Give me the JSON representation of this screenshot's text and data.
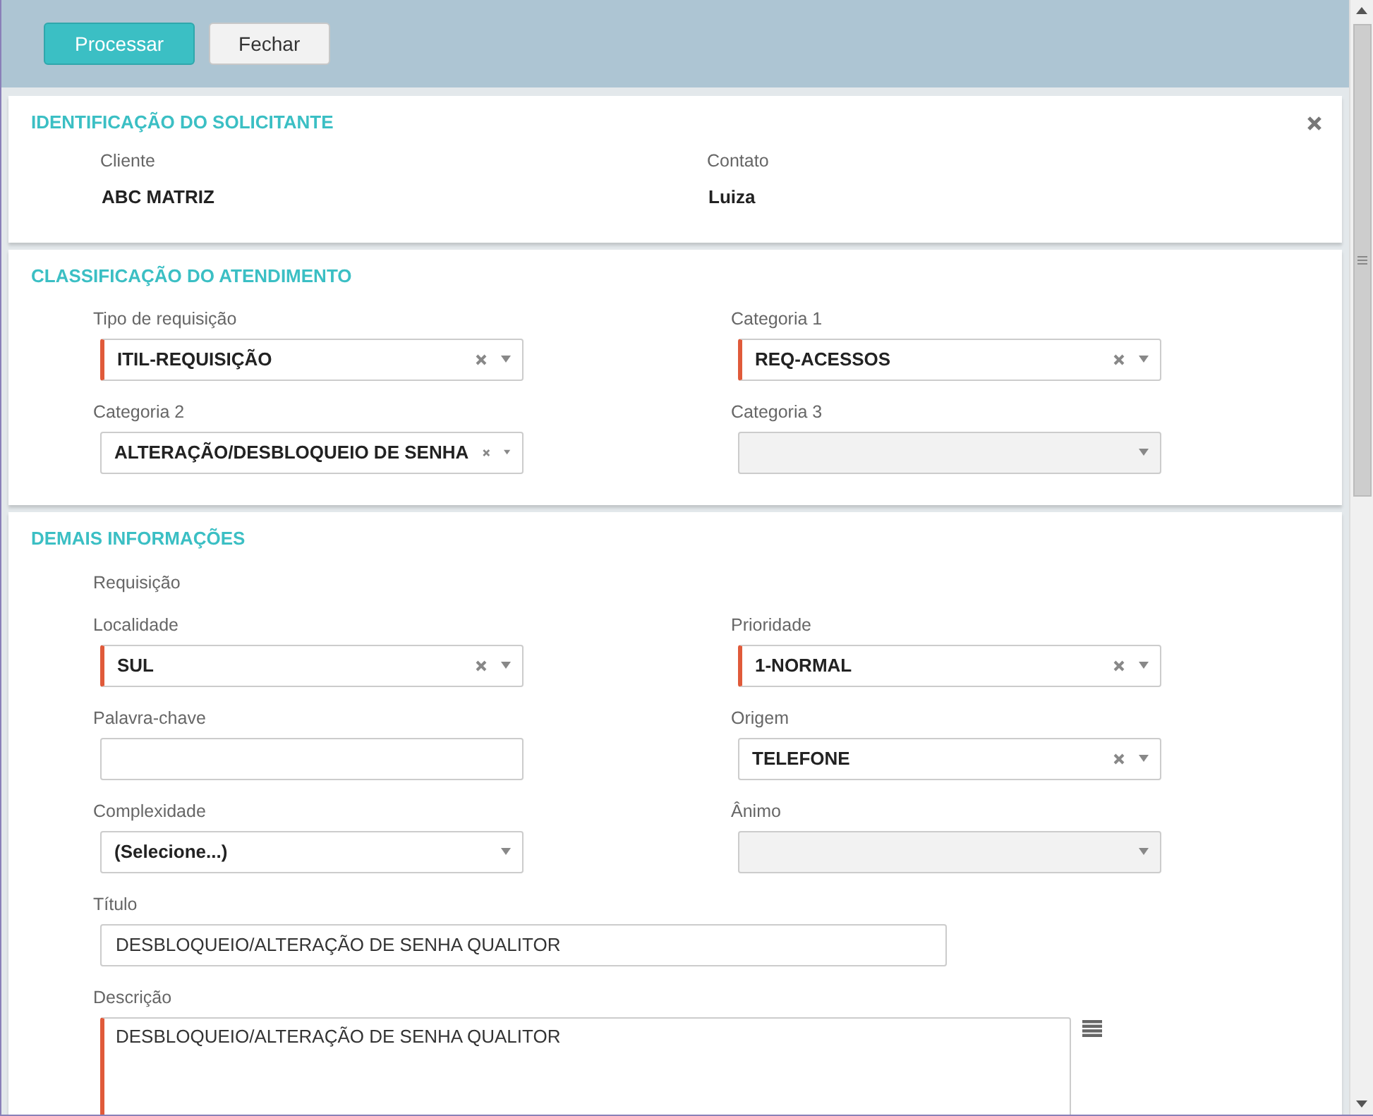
{
  "toolbar": {
    "buttons": [
      {
        "label": "Processar",
        "kind": "primary"
      },
      {
        "label": "Fechar",
        "kind": "default"
      }
    ]
  },
  "sections": [
    {
      "title": "IDENTIFICAÇÃO DO SOLICITANTE",
      "closable": true,
      "info": [
        {
          "label": "Cliente",
          "value": "ABC MATRIZ"
        },
        {
          "label": "Contato",
          "value": "Luiza"
        }
      ]
    },
    {
      "title": "CLASSIFICAÇÃO DO ATENDIMENTO",
      "closable": false,
      "fields": [
        {
          "label": "Tipo de requisição",
          "kind": "select",
          "value": "ITIL-REQUISIÇÃO",
          "required": true,
          "clearable": true,
          "disabled": false
        },
        {
          "label": "Categoria 1",
          "kind": "select",
          "value": "REQ-ACESSOS",
          "required": true,
          "clearable": true,
          "disabled": false
        },
        {
          "label": "Categoria 2",
          "kind": "select",
          "value": "ALTERAÇÃO/DESBLOQUEIO DE SENHA",
          "required": false,
          "clearable": true,
          "disabled": false
        },
        {
          "label": "Categoria 3",
          "kind": "select",
          "required": false,
          "clearable": false,
          "disabled": true
        }
      ]
    },
    {
      "title": "DEMAIS INFORMAÇÕES",
      "closable": false,
      "note": "Requisição",
      "fields": [
        {
          "label": "Localidade",
          "kind": "select",
          "value": "SUL",
          "required": true,
          "clearable": true,
          "disabled": false
        },
        {
          "label": "Prioridade",
          "kind": "select",
          "value": "1-NORMAL",
          "required": true,
          "clearable": true,
          "disabled": false
        },
        {
          "label": "Palavra-chave",
          "kind": "text",
          "required": false
        },
        {
          "label": "Origem",
          "kind": "select",
          "value": "TELEFONE",
          "required": false,
          "clearable": true,
          "disabled": false
        },
        {
          "label": "Complexidade",
          "kind": "select",
          "value": "(Selecione...)",
          "required": false,
          "clearable": false,
          "disabled": false
        },
        {
          "label": "Ânimo",
          "kind": "select",
          "required": false,
          "clearable": false,
          "disabled": true
        }
      ],
      "long_fields": [
        {
          "label": "Título",
          "kind": "text",
          "value": "DESBLOQUEIO/ALTERAÇÃO DE SENHA QUALITOR",
          "required": false
        },
        {
          "label": "Descrição",
          "kind": "textarea",
          "value": "DESBLOQUEIO/ALTERAÇÃO DE SENHA QUALITOR",
          "required": true
        }
      ]
    }
  ]
}
